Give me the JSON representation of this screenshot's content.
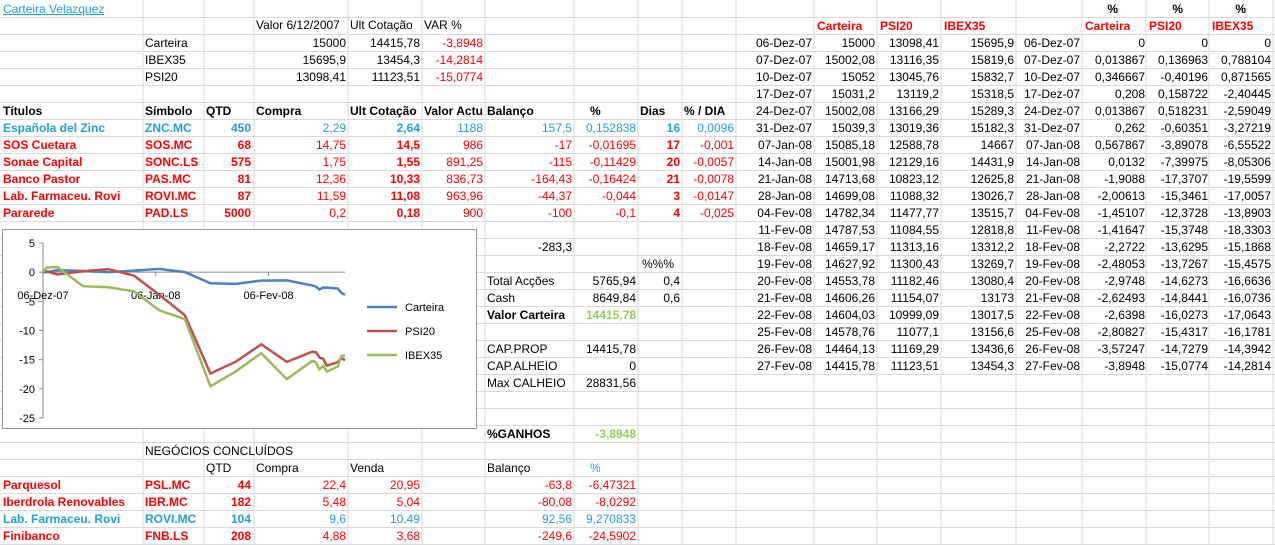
{
  "title": "Carteira Velazquez",
  "summary": {
    "headers": [
      "Valor 6/12/2007",
      "Ult Cotação",
      "VAR %"
    ],
    "rows": [
      {
        "name": "Carteira",
        "valor": "15000",
        "ult": "14415,78",
        "var": "-3,8948"
      },
      {
        "name": "IBEX35",
        "valor": "15695,9",
        "ult": "13454,3",
        "var": "-14,2814"
      },
      {
        "name": "PSI20",
        "valor": "13098,41",
        "ult": "11123,51",
        "var": "-15,0774"
      }
    ]
  },
  "holdings": {
    "headers": [
      "Títulos",
      "Símbolo",
      "QTD",
      "Compra",
      "Ult Cotação",
      "Valor Actual",
      "Balanço",
      "%",
      "Dias",
      "% / DIA"
    ],
    "rows": [
      {
        "name": "Española del Zinc",
        "sym": "ZNC.MC",
        "qtd": "450",
        "compra": "2,29",
        "ult": "2,64",
        "valor": "1188",
        "bal": "157,5",
        "pct": "0,152838",
        "dias": "16",
        "pd": "0,0096",
        "color": "blue"
      },
      {
        "name": "SOS Cuetara",
        "sym": "SOS.MC",
        "qtd": "68",
        "compra": "14,75",
        "ult": "14,5",
        "valor": "986",
        "bal": "-17",
        "pct": "-0,01695",
        "dias": "17",
        "pd": "-0,001",
        "color": "red"
      },
      {
        "name": "Sonae Capital",
        "sym": "SONC.LS",
        "qtd": "575",
        "compra": "1,75",
        "ult": "1,55",
        "valor": "891,25",
        "bal": "-115",
        "pct": "-0,11429",
        "dias": "20",
        "pd": "-0,0057",
        "color": "red"
      },
      {
        "name": "Banco Pastor",
        "sym": "PAS.MC",
        "qtd": "81",
        "compra": "12,36",
        "ult": "10,33",
        "valor": "836,73",
        "bal": "-164,43",
        "pct": "-0,16424",
        "dias": "21",
        "pd": "-0,0078",
        "color": "red"
      },
      {
        "name": "Lab. Farmaceu. Rovi",
        "sym": "ROVI.MC",
        "qtd": "87",
        "compra": "11,59",
        "ult": "11,08",
        "valor": "963,96",
        "bal": "-44,37",
        "pct": "-0,044",
        "dias": "3",
        "pd": "-0,0147",
        "color": "red"
      },
      {
        "name": "Pararede",
        "sym": "PAD.LS",
        "qtd": "5000",
        "compra": "0,2",
        "ult": "0,18",
        "valor": "900",
        "bal": "-100",
        "pct": "-0,1",
        "dias": "4",
        "pd": "-0,025",
        "color": "red"
      }
    ]
  },
  "totals": {
    "balanco_total": "-283,3",
    "pct_header": "%%%",
    "total_accoes_label": "Total Acções",
    "total_accoes": "5765,94",
    "total_accoes_pct": "0,4",
    "cash_label": "Cash",
    "cash": "8649,84",
    "cash_pct": "0,6",
    "valor_carteira_label": "Valor Carteira",
    "valor_carteira": "14415,78",
    "cap_prop_label": "CAP.PROP",
    "cap_prop": "14415,78",
    "cap_alheio_label": "CAP.ALHEIO",
    "cap_alheio": "0",
    "max_calheio_label": "Max CALHEIO",
    "max_calheio": "28831,56",
    "ganhos_label": "%GANHOS",
    "ganhos": "-3,8948"
  },
  "closed": {
    "title": "NEGÓCIOS CONCLUÍDOS",
    "headers": [
      "QTD",
      "Compra",
      "Venda",
      "Balanço",
      "%"
    ],
    "rows": [
      {
        "name": "Parquesol",
        "sym": "PSL.MC",
        "qtd": "44",
        "compra": "22,4",
        "venda": "20,95",
        "bal": "-63,8",
        "pct": "-6,47321",
        "color": "red"
      },
      {
        "name": "Iberdrola Renovables",
        "sym": "IBR.MC",
        "qtd": "182",
        "compra": "5,48",
        "venda": "5,04",
        "bal": "-80,08",
        "pct": "-8,0292",
        "color": "red"
      },
      {
        "name": "Lab. Farmaceu. Rovi",
        "sym": "ROVI.MC",
        "qtd": "104",
        "compra": "9,6",
        "venda": "10,49",
        "bal": "92,56",
        "pct": "9,270833",
        "color": "blue"
      },
      {
        "name": "Finibanco",
        "sym": "FNB.LS",
        "qtd": "208",
        "compra": "4,88",
        "venda": "3,68",
        "bal": "-249,6",
        "pct": "-24,5902",
        "color": "red"
      }
    ]
  },
  "history": {
    "headers": [
      "Carteira",
      "PSI20",
      "IBEX35"
    ],
    "rows": [
      {
        "date": "06-Dez-07",
        "c": "15000",
        "p": "13098,41",
        "i": "15695,9"
      },
      {
        "date": "07-Dez-07",
        "c": "15002,08",
        "p": "13116,35",
        "i": "15819,6"
      },
      {
        "date": "10-Dez-07",
        "c": "15052",
        "p": "13045,76",
        "i": "15832,7"
      },
      {
        "date": "17-Dez-07",
        "c": "15031,2",
        "p": "13119,2",
        "i": "15318,5"
      },
      {
        "date": "24-Dez-07",
        "c": "15002,08",
        "p": "13166,29",
        "i": "15289,3"
      },
      {
        "date": "31-Dez-07",
        "c": "15039,3",
        "p": "13019,36",
        "i": "15182,3"
      },
      {
        "date": "07-Jan-08",
        "c": "15085,18",
        "p": "12588,78",
        "i": "14667"
      },
      {
        "date": "14-Jan-08",
        "c": "15001,98",
        "p": "12129,16",
        "i": "14431,9"
      },
      {
        "date": "21-Jan-08",
        "c": "14713,68",
        "p": "10823,12",
        "i": "12625,8"
      },
      {
        "date": "28-Jan-08",
        "c": "14699,08",
        "p": "11088,32",
        "i": "13026,7"
      },
      {
        "date": "04-Fev-08",
        "c": "14782,34",
        "p": "11477,77",
        "i": "13515,7"
      },
      {
        "date": "11-Fev-08",
        "c": "14787,53",
        "p": "11084,55",
        "i": "12818,8"
      },
      {
        "date": "18-Fev-08",
        "c": "14659,17",
        "p": "11313,16",
        "i": "13312,2"
      },
      {
        "date": "19-Fev-08",
        "c": "14627,92",
        "p": "11300,43",
        "i": "13269,7"
      },
      {
        "date": "20-Fev-08",
        "c": "14553,78",
        "p": "11182,46",
        "i": "13080,4"
      },
      {
        "date": "21-Fev-08",
        "c": "14606,26",
        "p": "11154,07",
        "i": "13173"
      },
      {
        "date": "22-Fev-08",
        "c": "14604,03",
        "p": "10999,09",
        "i": "13017,5"
      },
      {
        "date": "25-Fev-08",
        "c": "14578,76",
        "p": "11077,1",
        "i": "13156,6"
      },
      {
        "date": "26-Fev-08",
        "c": "14464,13",
        "p": "11169,29",
        "i": "13436,6"
      },
      {
        "date": "27-Fev-08",
        "c": "14415,78",
        "p": "11123,51",
        "i": "13454,3"
      }
    ]
  },
  "pct_history": {
    "headers": [
      "%",
      "%",
      "%"
    ],
    "subheaders": [
      "Carteira",
      "PSI20",
      "IBEX35"
    ],
    "rows": [
      {
        "date": "06-Dez-07",
        "c": "0",
        "p": "0",
        "i": "0"
      },
      {
        "date": "07-Dez-07",
        "c": "0,013867",
        "p": "0,136963",
        "i": "0,788104"
      },
      {
        "date": "10-Dez-07",
        "c": "0,346667",
        "p": "-0,40196",
        "i": "0,871565"
      },
      {
        "date": "17-Dez-07",
        "c": "0,208",
        "p": "0,158722",
        "i": "-2,40445"
      },
      {
        "date": "24-Dez-07",
        "c": "0,013867",
        "p": "0,518231",
        "i": "-2,59049"
      },
      {
        "date": "31-Dez-07",
        "c": "0,262",
        "p": "-0,60351",
        "i": "-3,27219"
      },
      {
        "date": "07-Jan-08",
        "c": "0,567867",
        "p": "-3,89078",
        "i": "-6,55522"
      },
      {
        "date": "14-Jan-08",
        "c": "0,0132",
        "p": "-7,39975",
        "i": "-8,05306"
      },
      {
        "date": "21-Jan-08",
        "c": "-1,9088",
        "p": "-17,3707",
        "i": "-19,5599"
      },
      {
        "date": "28-Jan-08",
        "c": "-2,00613",
        "p": "-15,3461",
        "i": "-17,0057"
      },
      {
        "date": "04-Fev-08",
        "c": "-1,45107",
        "p": "-12,3728",
        "i": "-13,8903"
      },
      {
        "date": "11-Fev-08",
        "c": "-1,41647",
        "p": "-15,3748",
        "i": "-18,3303"
      },
      {
        "date": "18-Fev-08",
        "c": "-2,2722",
        "p": "-13,6295",
        "i": "-15,1868"
      },
      {
        "date": "19-Fev-08",
        "c": "-2,48053",
        "p": "-13,7267",
        "i": "-15,4575"
      },
      {
        "date": "20-Fev-08",
        "c": "-2,9748",
        "p": "-14,6273",
        "i": "-16,6636"
      },
      {
        "date": "21-Fev-08",
        "c": "-2,62493",
        "p": "-14,8441",
        "i": "-16,0736"
      },
      {
        "date": "22-Fev-08",
        "c": "-2,6398",
        "p": "-16,0273",
        "i": "-17,0643"
      },
      {
        "date": "25-Fev-08",
        "c": "-2,80827",
        "p": "-15,4317",
        "i": "-16,1781"
      },
      {
        "date": "26-Fev-08",
        "c": "-3,57247",
        "p": "-14,7279",
        "i": "-14,3942"
      },
      {
        "date": "27-Fev-08",
        "c": "-3,8948",
        "p": "-15,0774",
        "i": "-14,2814"
      }
    ]
  },
  "chart_data": {
    "type": "line",
    "title": "",
    "xlabel": "",
    "ylabel": "",
    "ylim": [
      -25,
      5
    ],
    "yticks": [
      "5",
      "0",
      "-5",
      "-10",
      "-15",
      "-20",
      "-25"
    ],
    "xtick_labels": [
      "06-Dez-07",
      "06-Jan-08",
      "06-Fev-08"
    ],
    "x": [
      "06-Dez-07",
      "07-Dez-07",
      "10-Dez-07",
      "17-Dez-07",
      "24-Dez-07",
      "31-Dez-07",
      "07-Jan-08",
      "14-Jan-08",
      "21-Jan-08",
      "28-Jan-08",
      "04-Fev-08",
      "11-Fev-08",
      "18-Fev-08",
      "19-Fev-08",
      "20-Fev-08",
      "21-Fev-08",
      "22-Fev-08",
      "25-Fev-08",
      "26-Fev-08",
      "27-Fev-08"
    ],
    "legend_position": "right",
    "series": [
      {
        "name": "Carteira",
        "color": "#4f81bd",
        "values": [
          0,
          0.013867,
          0.346667,
          0.208,
          0.013867,
          0.262,
          0.567867,
          0.0132,
          -1.9088,
          -2.00613,
          -1.45107,
          -1.41647,
          -2.2722,
          -2.48053,
          -2.9748,
          -2.62493,
          -2.6398,
          -2.80827,
          -3.57247,
          -3.8948
        ]
      },
      {
        "name": "PSI20",
        "color": "#c0504d",
        "values": [
          0,
          0.136963,
          -0.40196,
          0.158722,
          0.518231,
          -0.60351,
          -3.89078,
          -7.39975,
          -17.3707,
          -15.3461,
          -12.3728,
          -15.3748,
          -13.6295,
          -13.7267,
          -14.6273,
          -14.8441,
          -16.0273,
          -15.4317,
          -14.7279,
          -15.0774
        ]
      },
      {
        "name": "IBEX35",
        "color": "#9bbb59",
        "values": [
          0,
          0.788104,
          0.871565,
          -2.40445,
          -2.59049,
          -3.27219,
          -6.55522,
          -8.05306,
          -19.5599,
          -17.0057,
          -13.8903,
          -18.3303,
          -15.1868,
          -15.4575,
          -16.6636,
          -16.0736,
          -17.0643,
          -16.1781,
          -14.3942,
          -14.2814
        ]
      }
    ]
  }
}
